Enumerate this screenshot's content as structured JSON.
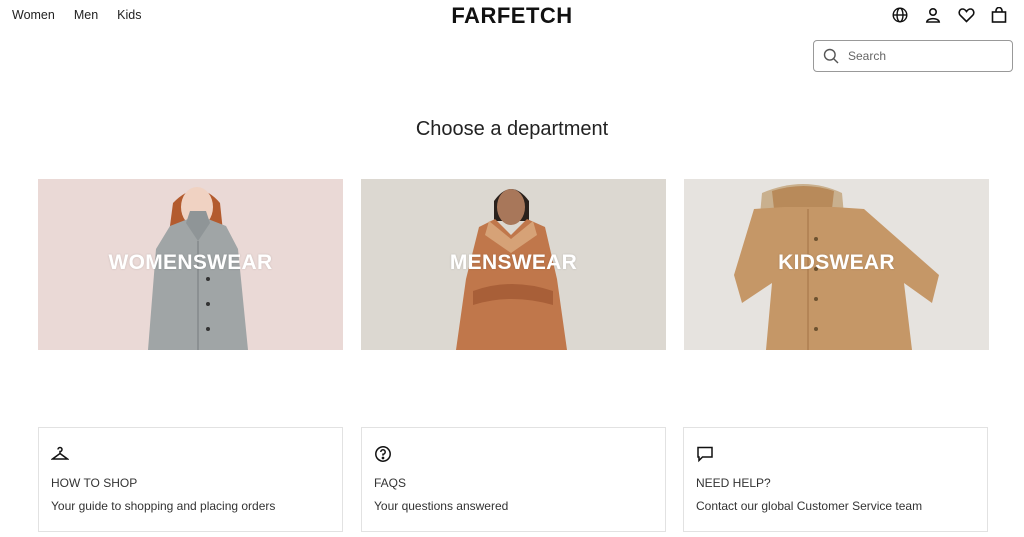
{
  "nav": {
    "women": "Women",
    "men": "Men",
    "kids": "Kids"
  },
  "brand": "FARFETCH",
  "header_icons": [
    "globe-icon",
    "account-icon",
    "wishlist-heart-icon",
    "shopping-bag-icon"
  ],
  "search": {
    "placeholder": "Search"
  },
  "heading": "Choose a department",
  "departments": [
    {
      "label": "WOMENSWEAR"
    },
    {
      "label": "MENSWEAR"
    },
    {
      "label": "KIDSWEAR"
    }
  ],
  "info": [
    {
      "icon": "hanger-icon",
      "title": "HOW TO SHOP",
      "desc": "Your guide to shopping and placing orders"
    },
    {
      "icon": "question-icon",
      "title": "FAQS",
      "desc": "Your questions answered"
    },
    {
      "icon": "chat-bubble-icon",
      "title": "NEED HELP?",
      "desc": "Contact our global Customer Service team"
    }
  ],
  "colors": {
    "text": "#222222",
    "border": "#e2e2e2",
    "search_border": "#999999"
  }
}
